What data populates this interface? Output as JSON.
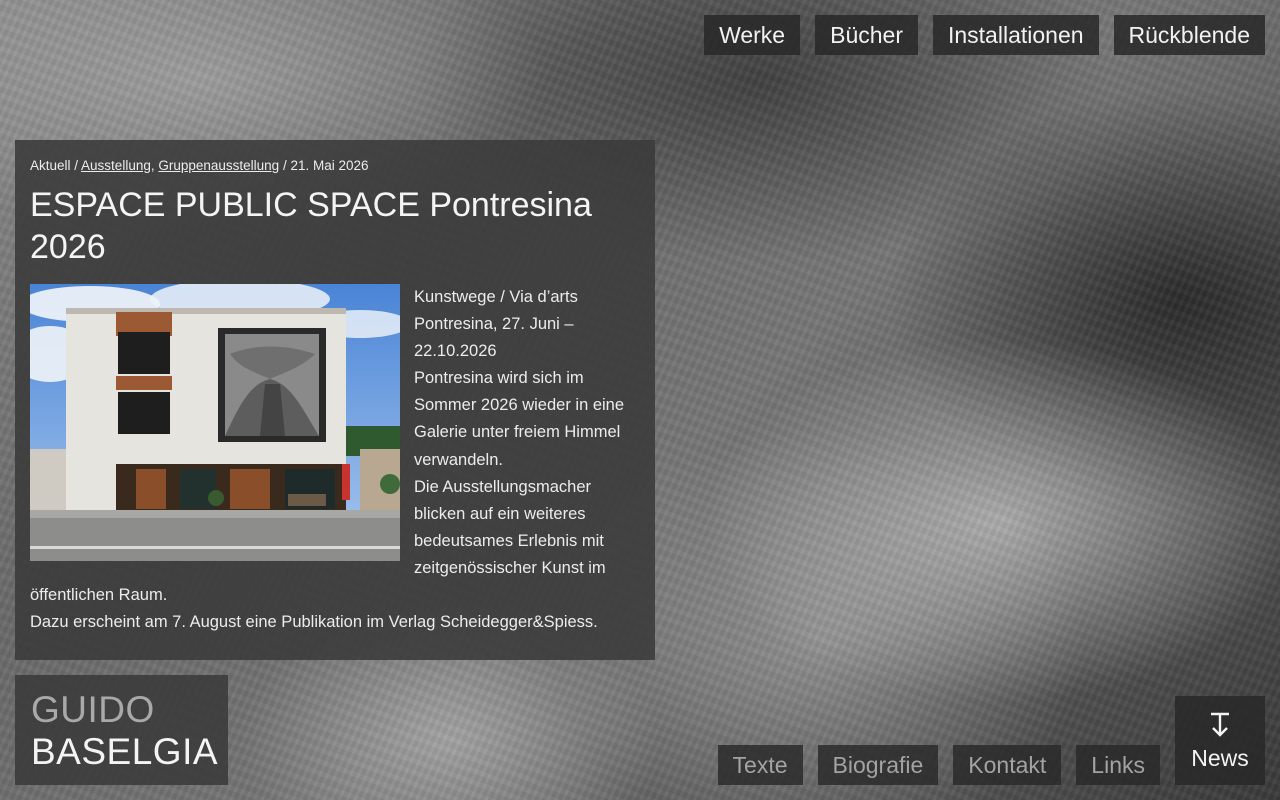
{
  "top_nav": [
    "Werke",
    "Bücher",
    "Installationen",
    "Rückblende"
  ],
  "post": {
    "breadcrumb": {
      "section": "Aktuell",
      "sep1": " / ",
      "cat1": "Ausstellung",
      "comma": ", ",
      "cat2": "Gruppenausstellung",
      "sep2": " / ",
      "date": "21. Mai 2026"
    },
    "title": "ESPACE PUBLIC SPACE Pontresina 2026",
    "lines": [
      "Kunstwege / Via d’arts Pontresina, 27. Juni – 22.10.2026",
      "Pontresina wird sich im Sommer 2026 wieder in eine Galerie unter freiem Himmel verwandeln.",
      "Die Ausstellungsmacher blicken auf ein weiteres bedeutsames Erlebnis mit zeitgenössischer Kunst im öffentlichen Raum.",
      "Dazu erscheint am 7. August eine Publikation im Verlag Scheidegger&Spiess."
    ]
  },
  "logo": {
    "first": "GUIDO",
    "last": "BASELGIA"
  },
  "bottom_nav": [
    "Texte",
    "Biografie",
    "Kontakt",
    "Links"
  ],
  "news": {
    "label": "News",
    "icon": "arrow-down-to-line-icon"
  }
}
